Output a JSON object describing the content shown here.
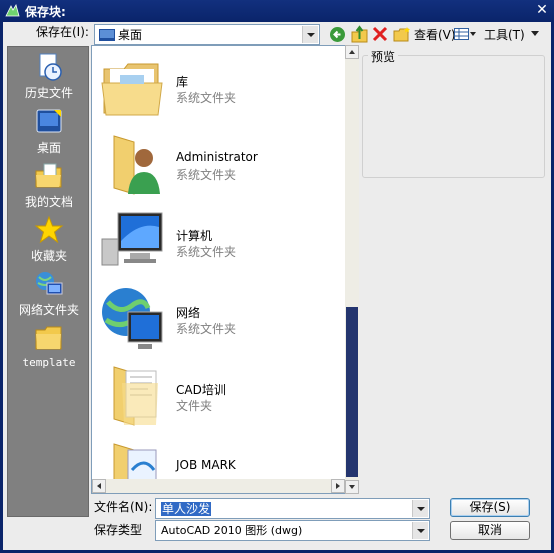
{
  "window": {
    "title": "保存块:"
  },
  "toolbar": {
    "save_in_label": "保存在(I):",
    "location": "桌面",
    "view_label": "查看(V)",
    "tools_label": "工具(T)"
  },
  "places": [
    {
      "label": "历史文件",
      "icon": "history-icon"
    },
    {
      "label": "桌面",
      "icon": "desktop-icon"
    },
    {
      "label": "我的文档",
      "icon": "my-documents-icon"
    },
    {
      "label": "收藏夹",
      "icon": "favorites-star-icon"
    },
    {
      "label": "网络文件夹",
      "icon": "network-folder-icon"
    },
    {
      "label": "template",
      "icon": "folder-icon"
    }
  ],
  "files": [
    {
      "name": "库",
      "type": "系统文件夹",
      "icon": "library-icon"
    },
    {
      "name": "Administrator",
      "type": "系统文件夹",
      "icon": "user-folder-icon"
    },
    {
      "name": "计算机",
      "type": "系统文件夹",
      "icon": "computer-icon"
    },
    {
      "name": "网络",
      "type": "系统文件夹",
      "icon": "network-icon"
    },
    {
      "name": "CAD培训",
      "type": "文件夹",
      "icon": "folder-icon"
    },
    {
      "name": "JOB MARK",
      "type": "",
      "icon": "folder-icon"
    }
  ],
  "preview": {
    "label": "预览"
  },
  "form": {
    "filename_label": "文件名(N):",
    "filename_value": "单人沙发",
    "filetype_label": "保存类型",
    "filetype_value": "AutoCAD 2010 图形 (dwg)"
  },
  "buttons": {
    "save": "保存(S)",
    "cancel": "取消"
  },
  "colors": {
    "titlebar": "#0a246a",
    "places_bg": "#808080",
    "scroll_thumb": "#24356e",
    "selection": "#316ac5"
  }
}
